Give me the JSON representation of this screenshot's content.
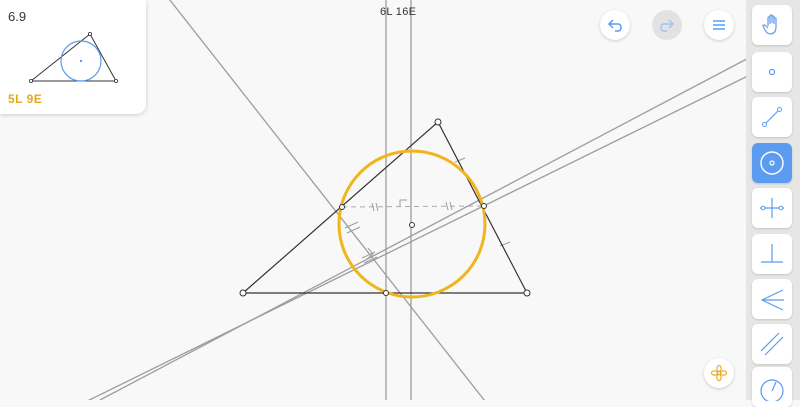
{
  "level": {
    "number": "6.9",
    "goal": "5L 9E"
  },
  "moves": "6L 16E",
  "header": {
    "undo_icon": "undo-icon",
    "redo_icon": "redo-icon",
    "menu_icon": "hamburger-menu-icon"
  },
  "toolbar": {
    "tools": [
      {
        "id": "move",
        "icon": "hand-icon",
        "active": false
      },
      {
        "id": "point",
        "icon": "point-icon",
        "active": false
      },
      {
        "id": "line",
        "icon": "line-icon",
        "active": false
      },
      {
        "id": "circle",
        "icon": "circle-icon",
        "active": true
      },
      {
        "id": "perpendicular-bisector",
        "icon": "perpendicular-bisector-icon",
        "active": false
      },
      {
        "id": "perpendicular",
        "icon": "perpendicular-icon",
        "active": false
      },
      {
        "id": "angle-bisector",
        "icon": "angle-bisector-icon",
        "active": false
      },
      {
        "id": "parallel",
        "icon": "parallel-icon",
        "active": false
      },
      {
        "id": "compass",
        "icon": "compass-icon",
        "active": false
      }
    ]
  },
  "hint_icon": "flower-hint-icon",
  "colors": {
    "accent": "#5b9bf0",
    "goal": "#e8a719",
    "circle": "#f0b41c",
    "construction_line": "#9d9d9d",
    "triangle": "#333333"
  }
}
